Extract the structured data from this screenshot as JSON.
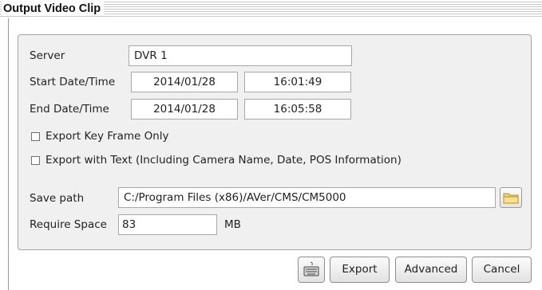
{
  "window": {
    "title": "Output Video Clip"
  },
  "form": {
    "server": {
      "label": "Server",
      "value": "DVR 1"
    },
    "start": {
      "label": "Start Date/Time",
      "date": "2014/01/28",
      "time": "16:01:49"
    },
    "end": {
      "label": "End Date/Time",
      "date": "2014/01/28",
      "time": "16:05:58"
    },
    "key_frame": {
      "label": "Export Key Frame Only",
      "checked": false
    },
    "with_text": {
      "label": "Export with Text (Including Camera Name, Date, POS Information)",
      "checked": false
    },
    "save_path": {
      "label": "Save path",
      "value": "C:/Program Files (x86)/AVer/CMS/CM5000"
    },
    "require_space": {
      "label": "Require Space",
      "value": "83",
      "unit": "MB"
    }
  },
  "buttons": {
    "export": "Export",
    "advanced": "Advanced",
    "cancel": "Cancel"
  },
  "icons": {
    "browse": "folder-icon",
    "keyboard": "keyboard-icon"
  }
}
